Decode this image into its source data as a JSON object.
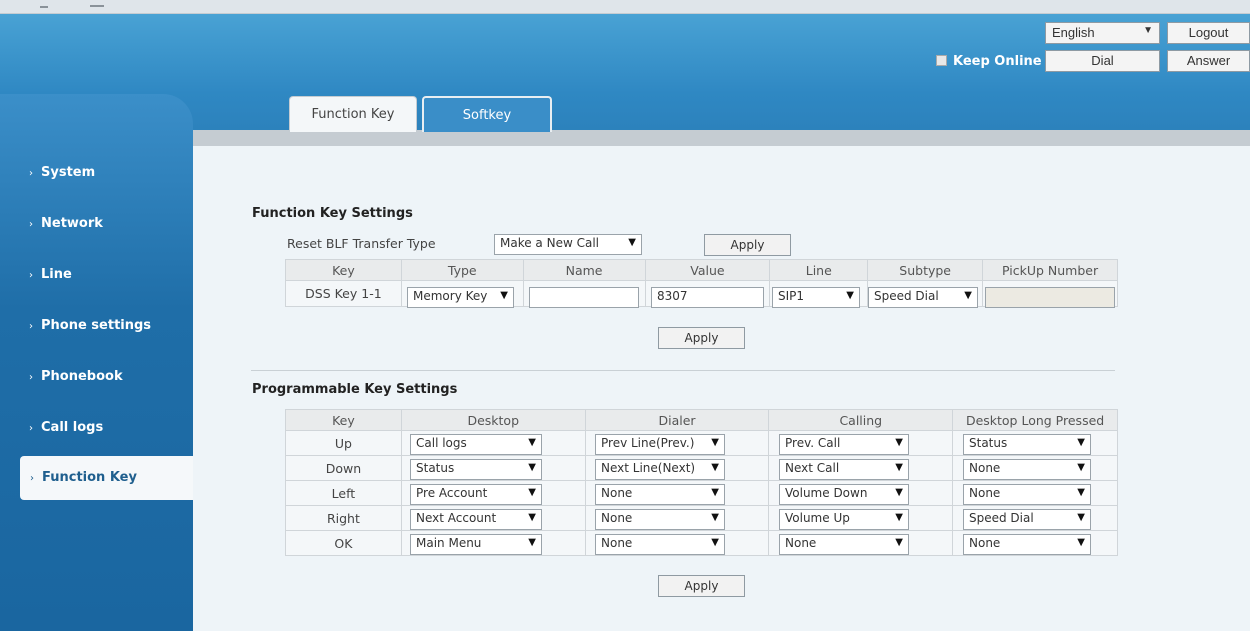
{
  "header": {
    "language": "English",
    "logout_label": "Logout",
    "dial_label": "Dial",
    "answer_label": "Answer",
    "keep_online_label": "Keep Online"
  },
  "tabs": [
    {
      "label": "Function Key",
      "active": true
    },
    {
      "label": "Softkey",
      "active": false
    }
  ],
  "sidebar": {
    "items": [
      {
        "label": "System"
      },
      {
        "label": "Network"
      },
      {
        "label": "Line"
      },
      {
        "label": "Phone settings"
      },
      {
        "label": "Phonebook"
      },
      {
        "label": "Call logs"
      },
      {
        "label": "Function Key",
        "active": true
      }
    ]
  },
  "function_key": {
    "title": "Function Key Settings",
    "reset_label": "Reset BLF Transfer Type",
    "reset_value": "Make a New Call",
    "apply_label": "Apply",
    "columns": [
      "Key",
      "Type",
      "Name",
      "Value",
      "Line",
      "Subtype",
      "PickUp Number"
    ],
    "row": {
      "key": "DSS Key 1-1",
      "type": "Memory Key",
      "name": "",
      "value": "8307",
      "line": "SIP1",
      "subtype": "Speed Dial",
      "pickup": ""
    },
    "apply2_label": "Apply"
  },
  "programmable": {
    "title": "Programmable Key Settings",
    "columns": [
      "Key",
      "Desktop",
      "Dialer",
      "Calling",
      "Desktop Long Pressed"
    ],
    "rows": [
      {
        "key": "Up",
        "desktop": "Call logs",
        "dialer": "Prev Line(Prev.)",
        "calling": "Prev. Call",
        "long": "Status"
      },
      {
        "key": "Down",
        "desktop": "Status",
        "dialer": "Next Line(Next)",
        "calling": "Next Call",
        "long": "None"
      },
      {
        "key": "Left",
        "desktop": "Pre Account",
        "dialer": "None",
        "calling": "Volume Down",
        "long": "None"
      },
      {
        "key": "Right",
        "desktop": "Next Account",
        "dialer": "None",
        "calling": "Volume Up",
        "long": "Speed Dial"
      },
      {
        "key": "OK",
        "desktop": "Main Menu",
        "dialer": "None",
        "calling": "None",
        "long": "None"
      }
    ],
    "apply_label": "Apply"
  }
}
